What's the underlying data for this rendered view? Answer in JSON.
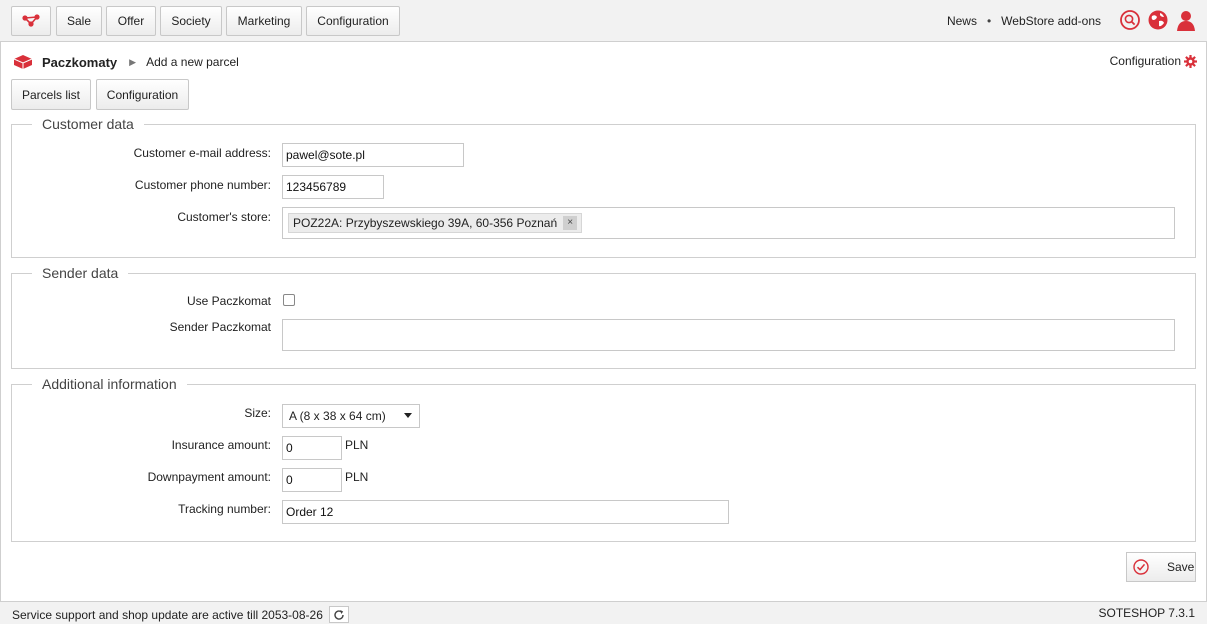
{
  "topnav": {
    "items": [
      "Sale",
      "Offer",
      "Society",
      "Marketing",
      "Configuration"
    ],
    "links": [
      "News",
      "WebStore add-ons"
    ],
    "separator": "•"
  },
  "breadcrumb": {
    "module": "Paczkomaty",
    "current": "Add a new parcel"
  },
  "config_link": "Configuration",
  "tabs": [
    "Parcels list",
    "Configuration"
  ],
  "customer": {
    "legend": "Customer data",
    "email_label": "Customer e-mail address:",
    "email_value": "pawel@sote.pl",
    "phone_label": "Customer phone number:",
    "phone_value": "123456789",
    "store_label": "Customer's store:",
    "store_value": "POZ22A: Przybyszewskiego 39A, 60-356 Poznań",
    "remove": "×"
  },
  "sender": {
    "legend": "Sender data",
    "use_label": "Use Paczkomat",
    "paczkomat_label": "Sender Paczkomat"
  },
  "additional": {
    "legend": "Additional information",
    "size_label": "Size:",
    "size_value": "A (8 x 38 x 64 cm)",
    "insurance_label": "Insurance amount:",
    "insurance_value": "0",
    "downpayment_label": "Downpayment amount:",
    "downpayment_value": "0",
    "currency": "PLN",
    "tracking_label": "Tracking number:",
    "tracking_value": "Order 12"
  },
  "save_label": "Save",
  "footer": {
    "support": "Service support and shop update are active till 2053-08-26",
    "version": "SOTESHOP 7.3.1"
  },
  "colors": {
    "accent": "#d9303a"
  }
}
